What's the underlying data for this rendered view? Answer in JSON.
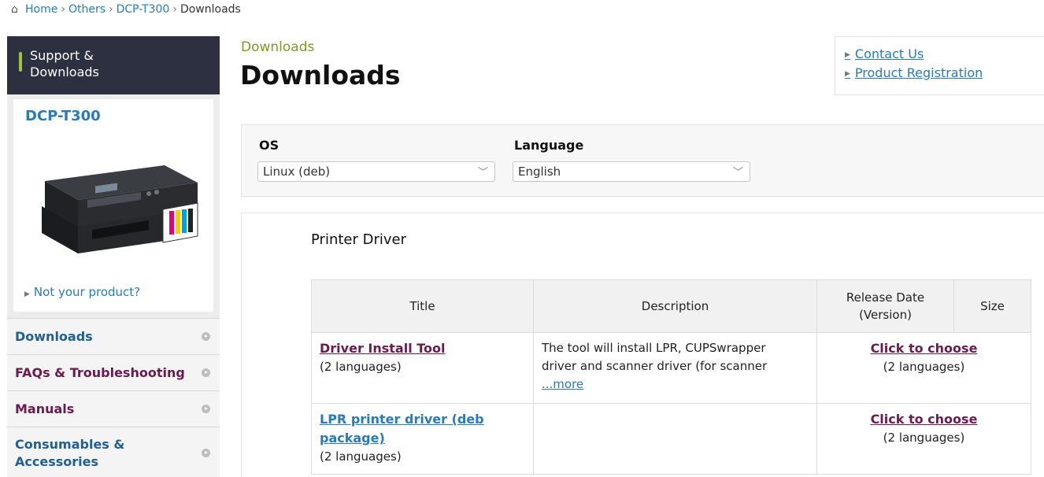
{
  "breadcrumb": {
    "items": [
      "Home",
      "Others",
      "DCP-T300"
    ],
    "current": "Downloads"
  },
  "sidebar": {
    "header_line1": "Support &",
    "header_line2": "Downloads",
    "product_name": "DCP-T300",
    "not_product": "Not your product?",
    "nav": [
      {
        "line1": "Downloads",
        "line2": ""
      },
      {
        "line1": "FAQs & Troubleshooting",
        "line2": ""
      },
      {
        "line1": "Manuals",
        "line2": ""
      },
      {
        "line1": "Consumables &",
        "line2": "Accessories"
      }
    ]
  },
  "main": {
    "kicker": "Downloads",
    "title": "Downloads",
    "links": [
      "Contact Us",
      "Product Registration"
    ],
    "filters": {
      "os_label": "OS",
      "os_value": "Linux (deb)",
      "language_label": "Language",
      "language_value": "English"
    },
    "section_title": "Printer Driver",
    "table": {
      "headers": {
        "title": "Title",
        "description": "Description",
        "release_line1": "Release Date",
        "release_line2": "(Version)",
        "size": "Size"
      },
      "rows": [
        {
          "title": "Driver Install Tool",
          "title2": "",
          "languages": "(2 languages)",
          "desc_line1": "The tool will install LPR, CUPSwrapper",
          "desc_line2": "driver and scanner driver (for scanner",
          "more": "...more",
          "choose": "Click to choose",
          "choose_langs": "(2 languages)"
        },
        {
          "title": "LPR printer driver (deb",
          "title2": "package)",
          "languages": "(2 languages)",
          "desc_line1": "",
          "desc_line2": "",
          "more": "",
          "choose": "Click to choose",
          "choose_langs": "(2 languages)"
        }
      ]
    }
  },
  "colors": {
    "sidebar_header": "#2c3040",
    "accent_green": "#9dc43a",
    "link_blue": "#2a7ab8",
    "link_purple": "#6b1a4d"
  }
}
